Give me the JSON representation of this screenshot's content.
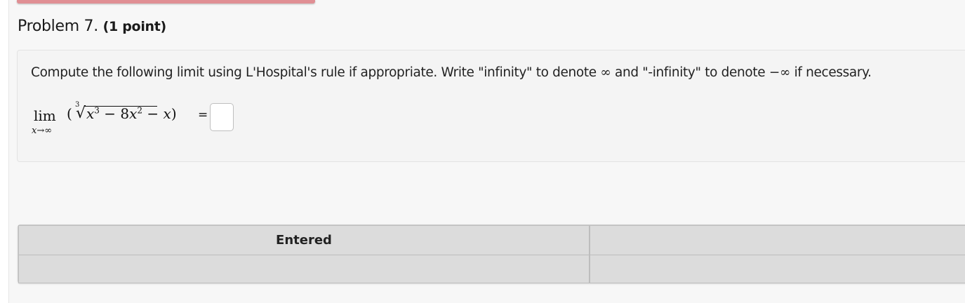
{
  "problem": {
    "title": "Problem 7.",
    "points": "(1 point)",
    "instructions_before_inf": "Compute the following limit using L'Hospital's rule if appropriate. Write \"infinity\" to denote",
    "inf_symbol": "∞",
    "instructions_middle": "and \"-infinity\" to denote",
    "neg_inf_symbol": "−∞",
    "instructions_after": "if necessary.",
    "expression": {
      "lim_word": "lim",
      "lim_subscript": "x→∞",
      "open_paren": "(",
      "root_index": "3",
      "radicand_x": "x",
      "radicand_exp1": "3",
      "radicand_mid": " − 8",
      "radicand_x2": "x",
      "radicand_exp2": "2",
      "tail_minus": " − ",
      "tail_x": "x",
      "close_paren": ")",
      "equals": "="
    },
    "answer_value": ""
  },
  "results_table": {
    "headers": [
      "Entered",
      ""
    ],
    "rows": [
      [
        "",
        ""
      ]
    ]
  },
  "colors": {
    "accent_bar": "#e08f94"
  }
}
